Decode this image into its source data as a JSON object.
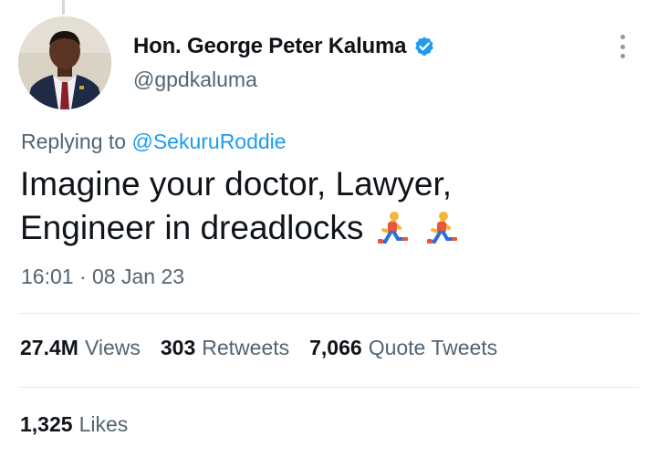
{
  "tweet": {
    "author": {
      "display_name": "Hon. George Peter Kaluma",
      "handle": "@gpdkaluma",
      "verified": true,
      "avatar_icon": "profile-photo"
    },
    "replying_prefix": "Replying to ",
    "replying_to": "@SekuruRoddie",
    "text_line1": "Imagine your doctor, Lawyer,",
    "text_line2": "Engineer in dreadlocks",
    "emojis": [
      "runner-emoji",
      "runner-emoji"
    ],
    "timestamp": "16:01 · 08 Jan 23"
  },
  "stats": {
    "views_count": "27.4M",
    "views_label": "Views",
    "retweets_count": "303",
    "retweets_label": "Retweets",
    "quotes_count": "7,066",
    "quotes_label": "Quote Tweets",
    "likes_count": "1,325",
    "likes_label": "Likes"
  },
  "colors": {
    "link": "#1d9bf0",
    "secondary_text": "#536471",
    "primary_text": "#0f1419",
    "verified_badge": "#1d9bf0"
  }
}
